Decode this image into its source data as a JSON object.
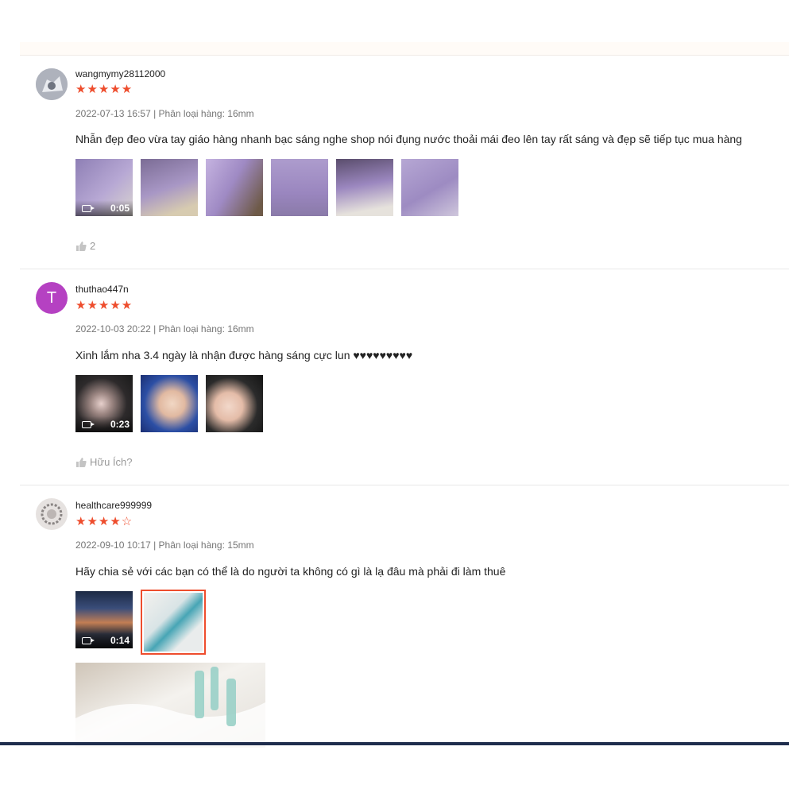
{
  "reviews": [
    {
      "username": "wangmymy28112000",
      "stars": "★★★★★",
      "rating": 5,
      "meta": "2022-07-13 16:57 | Phân loại hàng: 16mm",
      "comment": "Nhẫn đẹp đeo vừa tay giáo hàng nhanh bạc sáng nghe shop nói đụng nước thoải mái đeo lên tay rất sáng và đẹp sẽ tiếp tục mua hàng",
      "video_duration": "0:05",
      "like_label": "2"
    },
    {
      "username": "thuthao447n",
      "avatar_letter": "T",
      "stars": "★★★★★",
      "rating": 5,
      "meta": "2022-10-03 20:22 | Phân loại hàng: 16mm",
      "comment": "Xinh lắm nha 3.4 ngày là nhận được hàng sáng cực lun ♥♥♥♥♥♥♥♥♥",
      "video_duration": "0:23",
      "like_label": "Hữu Ích?"
    },
    {
      "username": "healthcare999999",
      "stars": "★★★★☆",
      "rating": 4,
      "meta": "2022-09-10 10:17 | Phân loại hàng: 15mm",
      "comment": "Hãy chia sẻ với các bạn có thể là do người ta không có gì là lạ đâu mà phải đi làm thuê",
      "video_duration": "0:14"
    }
  ],
  "colors": {
    "star": "#ee4d2d",
    "selected_border": "#ee4d2d",
    "avatar_letter_bg": "#b541c2"
  }
}
